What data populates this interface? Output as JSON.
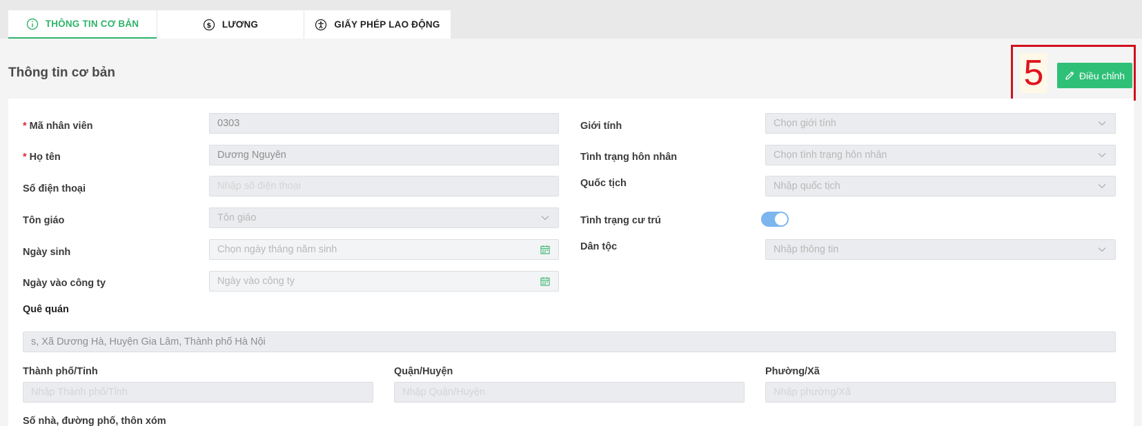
{
  "tabs": [
    {
      "label": "THÔNG TIN CƠ BẢN",
      "icon": "info-circle-icon",
      "active": true
    },
    {
      "label": "LƯƠNG",
      "icon": "dollar-circle-icon",
      "active": false
    },
    {
      "label": "GIẤY PHÉP LAO ĐỘNG",
      "icon": "accessibility-icon",
      "active": false
    }
  ],
  "header": {
    "title": "Thông tin cơ bản",
    "annotation_number": "5",
    "edit_label": "Điều chỉnh"
  },
  "form": {
    "employee_code": {
      "label": "Mã nhân viên",
      "required": "*",
      "value": "0303"
    },
    "full_name": {
      "label": "Họ tên",
      "required": "*",
      "value": "Dương Nguyên"
    },
    "phone": {
      "label": "Số điện thoại",
      "placeholder": "Nhập số điện thoại"
    },
    "religion": {
      "label": "Tôn giáo",
      "placeholder": "Tôn giáo"
    },
    "birth_date": {
      "label": "Ngày sinh",
      "placeholder": "Chọn ngày tháng năm sinh"
    },
    "join_date": {
      "label": "Ngày vào công ty",
      "placeholder": "Ngày vào công ty"
    },
    "gender": {
      "label": "Giới tính",
      "placeholder": "Chọn giới tính"
    },
    "marital_status": {
      "label": "Tình trạng hôn nhân",
      "placeholder": "Chọn tình trạng hôn nhân"
    },
    "nationality": {
      "label": "Quốc tịch",
      "placeholder": "Nhập quốc tịch"
    },
    "residence_status": {
      "label": "Tình trạng cư trú",
      "on": true
    },
    "ethnicity": {
      "label": "Dân tộc",
      "placeholder": "Nhập thông tin"
    },
    "hometown": {
      "label": "Quê quán",
      "value": "s, Xã Dương Hà, Huyện Gia Lâm, Thành phố Hà Nội"
    },
    "city": {
      "label": "Thành phố/Tỉnh",
      "placeholder": "Nhập Thành phố/Tỉnh"
    },
    "district": {
      "label": "Quận/Huyện",
      "placeholder": "Nhập Quận/Huyện"
    },
    "ward": {
      "label": "Phường/Xã",
      "placeholder": "Nhập phường/Xã"
    },
    "street": {
      "label": "Số nhà, đường phố, thôn xóm"
    }
  },
  "colors": {
    "accent": "#2fb36a",
    "button": "#2fc078",
    "required": "#e0283a",
    "annotation": "#d0101c",
    "toggle": "#7db5ee"
  }
}
